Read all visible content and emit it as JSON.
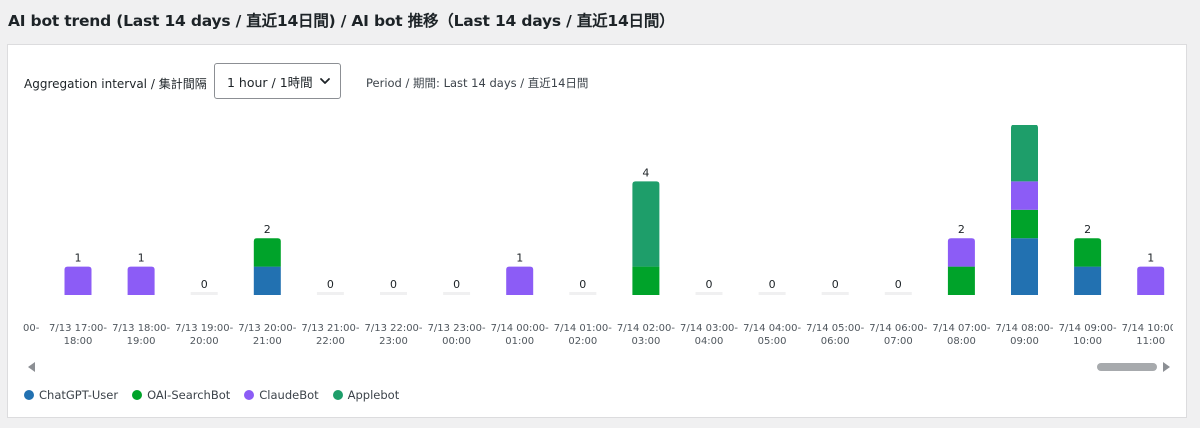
{
  "page": {
    "title": "AI bot trend (Last 14 days / 直近14日間) / AI bot 推移（Last 14 days / 直近14日間）"
  },
  "controls": {
    "interval_label": "Aggregation interval / 集計間隔",
    "interval_value": "1 hour / 1時間",
    "period_text": "Period / 期間: Last 14 days / 直近14日間"
  },
  "legend": [
    {
      "name": "ChatGPT-User",
      "color": "#2271b1"
    },
    {
      "name": "OAI-SearchBot",
      "color": "#00a32a"
    },
    {
      "name": "ClaudeBot",
      "color": "#8c5cf6"
    },
    {
      "name": "Applebot",
      "color": "#1e9e6a"
    }
  ],
  "chart_data": {
    "type": "bar",
    "stacked": true,
    "partial_left_label": "00-",
    "categories": [
      "7/13 17:00-18:00",
      "7/13 18:00-19:00",
      "7/13 19:00-20:00",
      "7/13 20:00-21:00",
      "7/13 21:00-22:00",
      "7/13 22:00-23:00",
      "7/13 23:00-00:00",
      "7/14 00:00-01:00",
      "7/14 01:00-02:00",
      "7/14 02:00-03:00",
      "7/14 03:00-04:00",
      "7/14 04:00-05:00",
      "7/14 05:00-06:00",
      "7/14 06:00-07:00",
      "7/14 07:00-08:00",
      "7/14 08:00-09:00",
      "7/14 09:00-10:00",
      "7/14 10:00-11:00"
    ],
    "tick_lines": [
      [
        "7/13 17:00-",
        "18:00"
      ],
      [
        "7/13 18:00-",
        "19:00"
      ],
      [
        "7/13 19:00-",
        "20:00"
      ],
      [
        "7/13 20:00-",
        "21:00"
      ],
      [
        "7/13 21:00-",
        "22:00"
      ],
      [
        "7/13 22:00-",
        "23:00"
      ],
      [
        "7/13 23:00-",
        "00:00"
      ],
      [
        "7/14 00:00-",
        "01:00"
      ],
      [
        "7/14 01:00-",
        "02:00"
      ],
      [
        "7/14 02:00-",
        "03:00"
      ],
      [
        "7/14 03:00-",
        "04:00"
      ],
      [
        "7/14 04:00-",
        "05:00"
      ],
      [
        "7/14 05:00-",
        "06:00"
      ],
      [
        "7/14 06:00-",
        "07:00"
      ],
      [
        "7/14 07:00-",
        "08:00"
      ],
      [
        "7/14 08:00-",
        "09:00"
      ],
      [
        "7/14 09:00-",
        "10:00"
      ],
      [
        "7/14 10:00-",
        "11:00"
      ]
    ],
    "series": [
      {
        "name": "ChatGPT-User",
        "color": "#2271b1",
        "values": [
          0,
          0,
          0,
          1,
          0,
          0,
          0,
          0,
          0,
          0,
          0,
          0,
          0,
          0,
          0,
          2,
          1,
          0
        ]
      },
      {
        "name": "OAI-SearchBot",
        "color": "#00a32a",
        "values": [
          0,
          0,
          0,
          1,
          0,
          0,
          0,
          0,
          0,
          1,
          0,
          0,
          0,
          0,
          1,
          1,
          1,
          0
        ]
      },
      {
        "name": "ClaudeBot",
        "color": "#8c5cf6",
        "values": [
          1,
          1,
          0,
          0,
          0,
          0,
          0,
          1,
          0,
          0,
          0,
          0,
          0,
          0,
          1,
          1,
          0,
          1
        ]
      },
      {
        "name": "Applebot",
        "color": "#1e9e6a",
        "values": [
          0,
          0,
          0,
          0,
          0,
          0,
          0,
          0,
          0,
          3,
          0,
          0,
          0,
          0,
          0,
          2,
          0,
          0
        ]
      }
    ],
    "totals": [
      1,
      1,
      0,
      2,
      0,
      0,
      0,
      1,
      0,
      4,
      0,
      0,
      0,
      0,
      2,
      6,
      2,
      1
    ],
    "ylim": [
      0,
      6
    ],
    "grid": false,
    "legend_position": "bottom-left"
  }
}
